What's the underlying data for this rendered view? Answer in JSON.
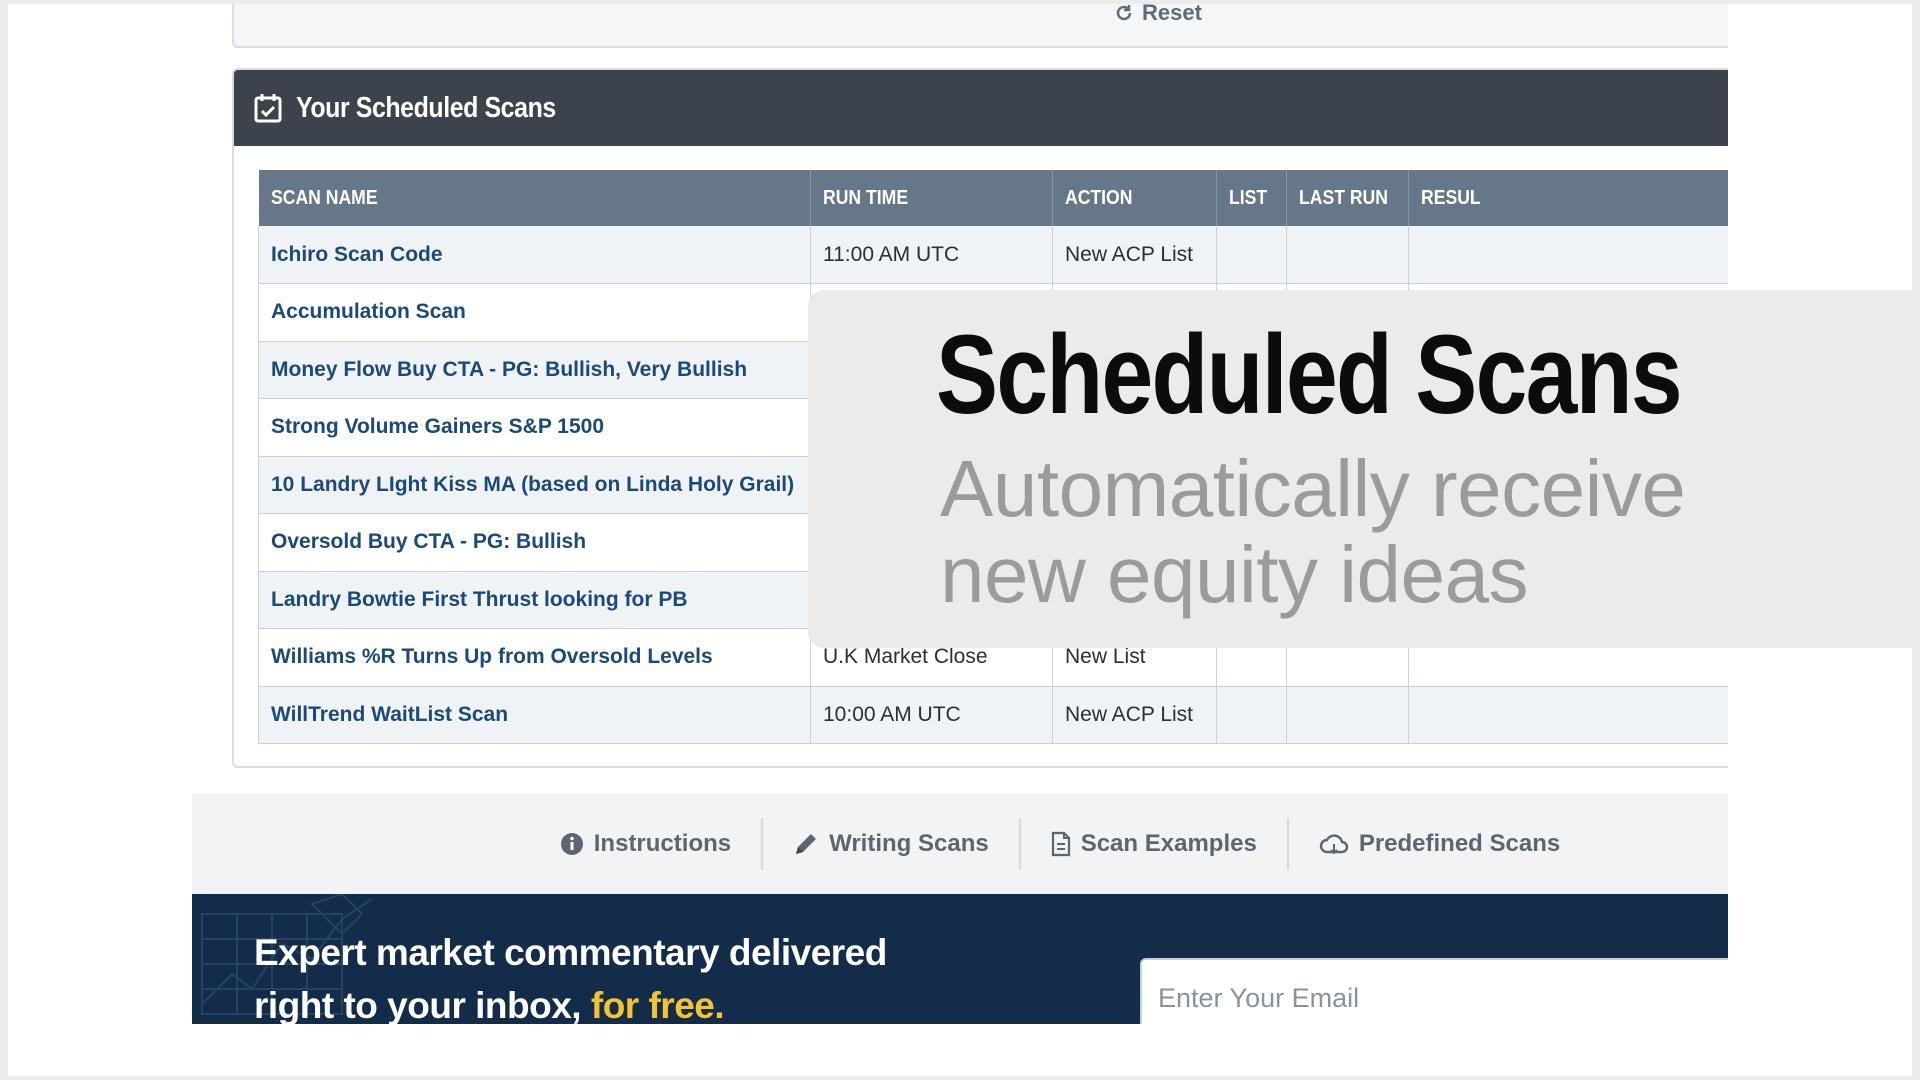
{
  "reset_card": {
    "reset_label": "Reset"
  },
  "scheduled_scans": {
    "title": "Your Scheduled Scans",
    "columns": [
      "SCAN NAME",
      "RUN TIME",
      "ACTION",
      "LIST",
      "LAST RUN",
      "RESUL"
    ],
    "rows": [
      {
        "name": "Ichiro Scan Code",
        "run_time": "11:00 AM UTC",
        "action": "New ACP List",
        "list": "",
        "last_run": "",
        "result": ""
      },
      {
        "name": "Accumulation Scan",
        "run_time": "",
        "action": "",
        "list": "",
        "last_run": "",
        "result": ""
      },
      {
        "name": "Money Flow Buy CTA - PG: Bullish, Very Bullish",
        "run_time": "",
        "action": "",
        "list": "",
        "last_run": "",
        "result": ""
      },
      {
        "name": "Strong Volume Gainers S&P 1500",
        "run_time": "",
        "action": "",
        "list": "",
        "last_run": "",
        "result": ""
      },
      {
        "name": "10 Landry LIght Kiss MA (based on Linda Holy Grail)",
        "run_time": "",
        "action": "",
        "list": "",
        "last_run": "",
        "result": ""
      },
      {
        "name": "Oversold Buy CTA - PG: Bullish",
        "run_time": "",
        "action": "",
        "list": "",
        "last_run": "",
        "result": ""
      },
      {
        "name": "Landry Bowtie First Thrust looking for PB",
        "run_time": "",
        "action": "",
        "list": "",
        "last_run": "",
        "result": ""
      },
      {
        "name": "Williams %R Turns Up from Oversold Levels",
        "run_time": "U.K Market Close",
        "action": "New List",
        "list": "",
        "last_run": "",
        "result": ""
      },
      {
        "name": "WillTrend WaitList Scan",
        "run_time": "10:00 AM UTC",
        "action": "New ACP List",
        "list": "",
        "last_run": "",
        "result": ""
      }
    ]
  },
  "footer_nav": {
    "items": [
      {
        "label": "Instructions",
        "icon": "info-icon"
      },
      {
        "label": "Writing Scans",
        "icon": "pencil-icon"
      },
      {
        "label": "Scan Examples",
        "icon": "document-icon"
      },
      {
        "label": "Predefined Scans",
        "icon": "cloud-icon"
      }
    ]
  },
  "newsletter": {
    "line1": "Expert market commentary delivered",
    "line2": "right to your inbox,",
    "accent": "for free.",
    "email_placeholder": "Enter Your Email",
    "accent_color": "#f5c232"
  },
  "overlay": {
    "title": "Scheduled Scans",
    "subtitle_line1": "Automatically receive",
    "subtitle_line2": "new equity ideas"
  }
}
